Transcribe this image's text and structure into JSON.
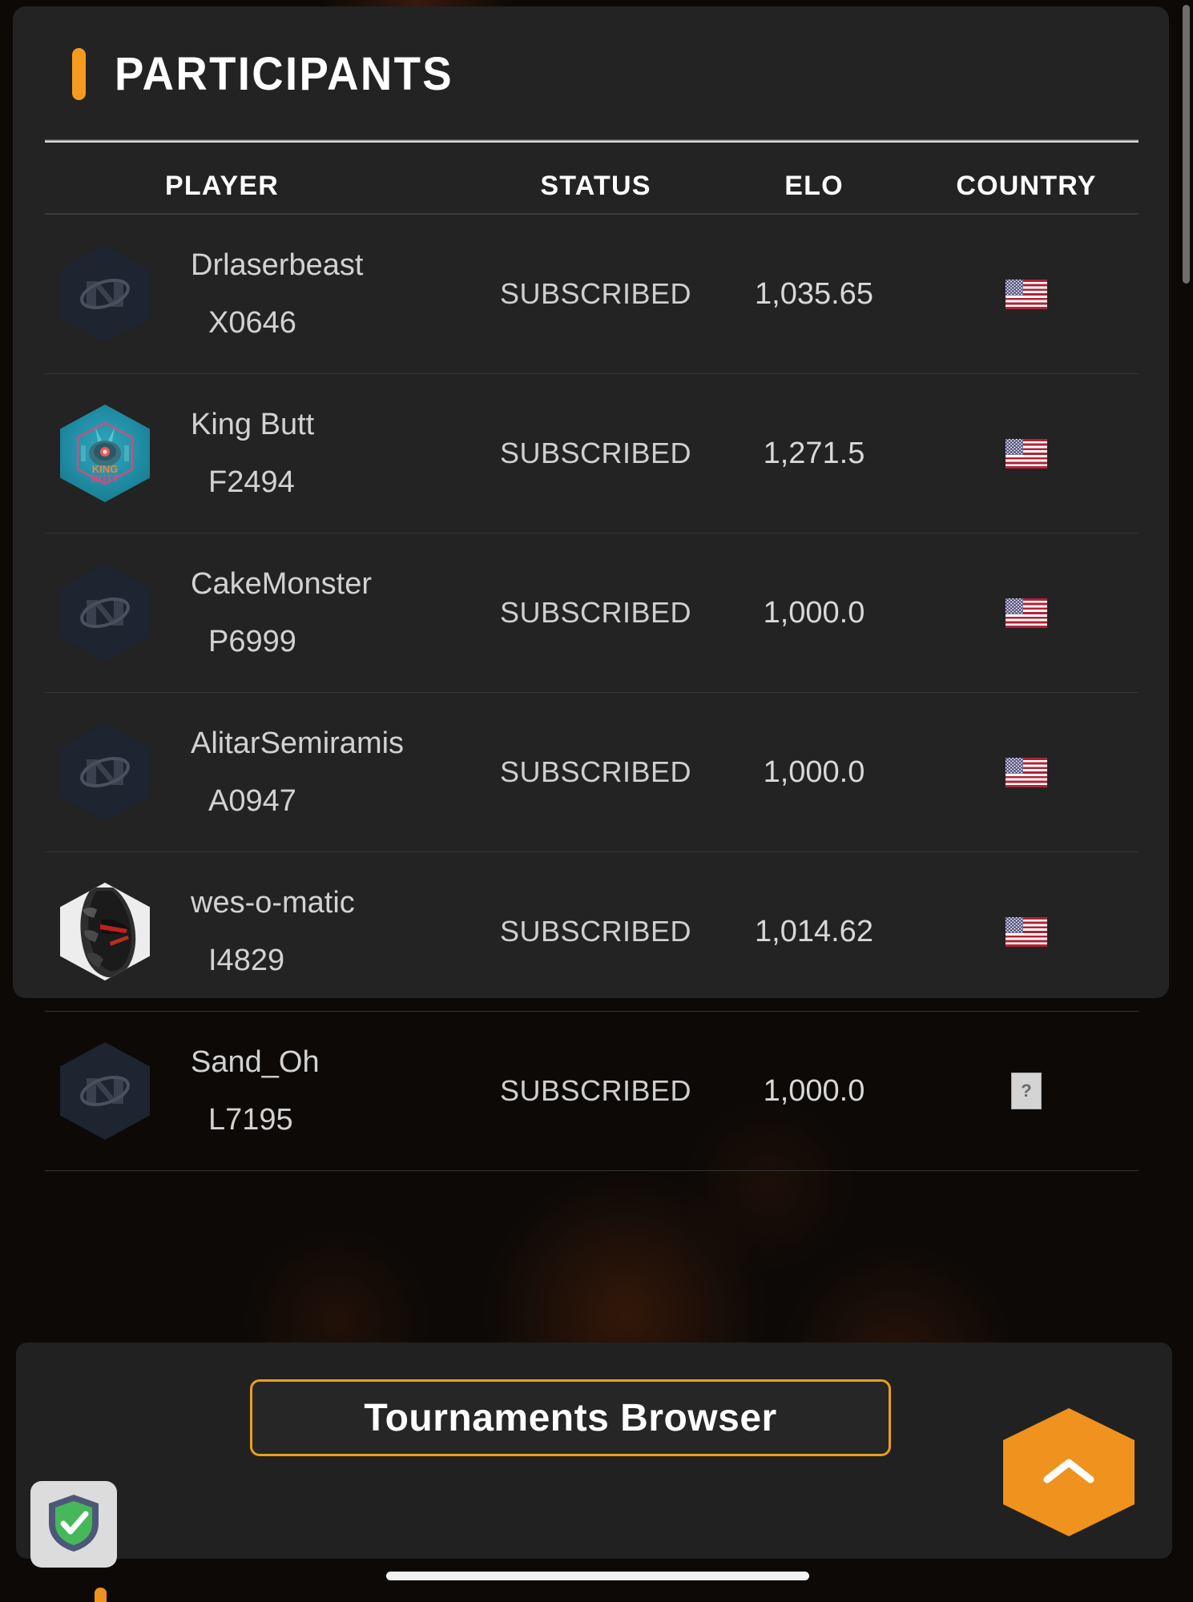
{
  "panel": {
    "title": "PARTICIPANTS",
    "accent_color": "#f59a1e"
  },
  "table": {
    "headers": {
      "player": "PLAYER",
      "status": "STATUS",
      "elo": "ELO",
      "country": "COUNTRY"
    },
    "rows": [
      {
        "name": "Drlaserbeast",
        "tag": "X0646",
        "status": "SUBSCRIBED",
        "elo": "1,035.65",
        "country": "us",
        "avatar": "default-hex-logo-avatar"
      },
      {
        "name": "King Butt",
        "tag": "F2494",
        "status": "SUBSCRIBED",
        "elo": "1,271.5",
        "country": "us",
        "avatar": "king-butt-cyberpunk-avatar"
      },
      {
        "name": "CakeMonster",
        "tag": "P6999",
        "status": "SUBSCRIBED",
        "elo": "1,000.0",
        "country": "us",
        "avatar": "default-hex-logo-avatar"
      },
      {
        "name": "AlitarSemiramis",
        "tag": "A0947",
        "status": "SUBSCRIBED",
        "elo": "1,000.0",
        "country": "us",
        "avatar": "default-hex-logo-avatar"
      },
      {
        "name": "wes-o-matic",
        "tag": "I4829",
        "status": "SUBSCRIBED",
        "elo": "1,014.62",
        "country": "us",
        "avatar": "mech-head-avatar"
      },
      {
        "name": "Sand_Oh",
        "tag": "L7195",
        "status": "SUBSCRIBED",
        "elo": "1,000.0",
        "country": "unknown",
        "avatar": "default-hex-logo-avatar"
      }
    ],
    "unknown_country_glyph": "?"
  },
  "bottom": {
    "tournaments_browser_label": "Tournaments Browser",
    "tournaments_border_color": "#e8a01c",
    "scroll_top_icon": "chevron-up-icon",
    "scroll_top_color": "#f0921e",
    "security_badge_icon": "shield-check-icon"
  }
}
